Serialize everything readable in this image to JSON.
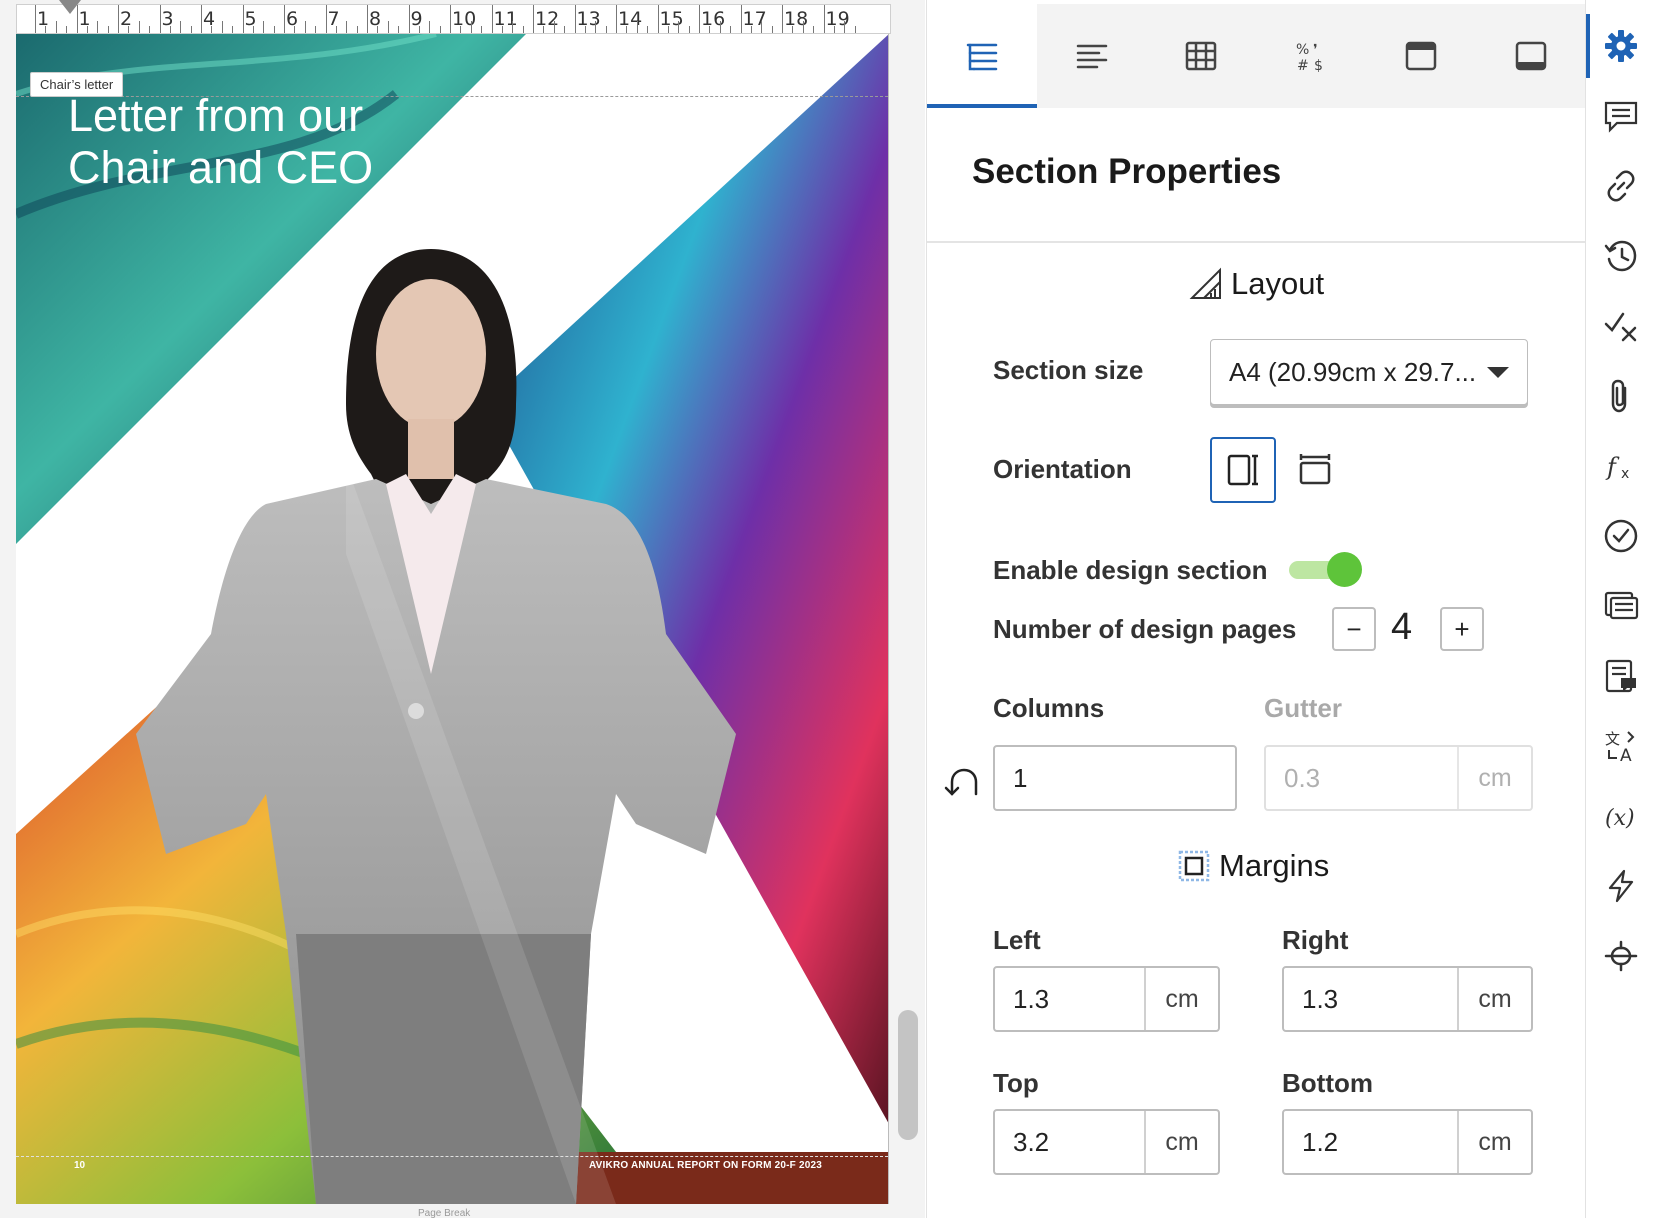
{
  "ruler": {
    "numbers": [
      "1",
      "1",
      "2",
      "3",
      "4",
      "5",
      "6",
      "7",
      "8",
      "9",
      "10",
      "11",
      "12",
      "13",
      "14",
      "15",
      "16",
      "17",
      "18",
      "19"
    ]
  },
  "document": {
    "section_tag": "Chair’s letter",
    "heading": "Letter from our Chair and CEO",
    "page_number": "10",
    "footer_text": "AVIKRO ANNUAL REPORT ON FORM 20-F 2023",
    "page_break_label": "Page Break"
  },
  "panel": {
    "tabs": [
      {
        "name": "section-properties-tab",
        "icon": "list-tree-icon",
        "active": true
      },
      {
        "name": "paragraph-tab",
        "icon": "align-left-icon",
        "active": false
      },
      {
        "name": "table-tab",
        "icon": "table-grid-icon",
        "active": false
      },
      {
        "name": "number-format-tab",
        "icon": "number-format-icon",
        "active": false
      },
      {
        "name": "header-tab",
        "icon": "header-icon",
        "active": false
      },
      {
        "name": "footer-tab",
        "icon": "footer-icon",
        "active": false
      }
    ],
    "title": "Section Properties",
    "layout": {
      "heading": "Layout",
      "section_size_label": "Section size",
      "section_size_value": "A4 (20.99cm x 29.7...",
      "orientation_label": "Orientation",
      "orientation_selected": "portrait",
      "design_section_label": "Enable design section",
      "design_section_enabled": true,
      "design_pages_label": "Number of design pages",
      "design_pages_value": "4",
      "decrement": "−",
      "increment": "+",
      "columns_label": "Columns",
      "columns_value": "1",
      "gutter_label": "Gutter",
      "gutter_value": "0.3",
      "gutter_unit": "cm"
    },
    "margins": {
      "heading": "Margins",
      "left_label": "Left",
      "left_value": "1.3",
      "right_label": "Right",
      "right_value": "1.3",
      "top_label": "Top",
      "top_value": "3.2",
      "bottom_label": "Bottom",
      "bottom_value": "1.2",
      "unit": "cm"
    }
  },
  "rail": {
    "items": [
      "gear-icon",
      "comment-icon",
      "link-icon",
      "history-icon",
      "check-cross-icon",
      "paperclip-icon",
      "function-icon",
      "check-circle-icon",
      "notes-icon",
      "comment-note-icon",
      "translate-icon",
      "variable-icon",
      "lightning-icon",
      "slider-icon"
    ]
  },
  "colors": {
    "accent": "#1f63b5",
    "toggle_on": "#5ec43a",
    "toggle_track": "#bde6a2"
  }
}
